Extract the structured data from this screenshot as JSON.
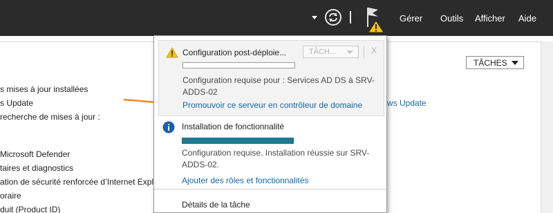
{
  "topbar": {
    "menu": [
      "Gérer",
      "Outils",
      "Afficher",
      "Aide"
    ]
  },
  "background": {
    "taches_label": "TÂCHES",
    "lines": [
      "s mises à jour installées",
      "s Update",
      "recherche de mises à jour :",
      "Microsoft Defender",
      "taires et diagnostics",
      "ation de sécurité renforcée d’Internet Explo",
      "oraire",
      "duit (Product ID)"
    ],
    "link": "ws Update"
  },
  "popup": {
    "task1": {
      "title": "Configuration post-déploie...",
      "taches_label": "TÂCH...",
      "close": "X",
      "progress": 0,
      "text": "Configuration requise pour : Services AD DS à SRV-ADDS-02",
      "link": "Promouvoir ce serveur en contrôleur de domaine"
    },
    "task2": {
      "title": "Installation de fonctionnalité",
      "progress": 1,
      "text": "Configuration requise. Installation réussie sur SRV-ADDS-02.",
      "link": "Ajouter des rôles et fonctionnalités"
    },
    "details": "Détails de la tâche"
  },
  "colors": {
    "topbar": "#2b2b2b",
    "link": "#1468a6",
    "progress": "#1f7a93",
    "warning": "#f5c400",
    "info": "#1a5fb4",
    "annotation_arrow": "#f08a24"
  },
  "icons": {
    "refresh": "refresh-icon",
    "flag": "notification-flag-icon",
    "warning": "warning-icon",
    "info": "info-icon"
  }
}
